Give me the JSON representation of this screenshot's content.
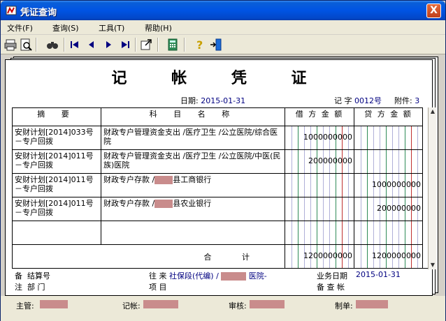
{
  "window": {
    "title": "凭证查询",
    "close_label": "X"
  },
  "menu": [
    {
      "label": "文件(F)"
    },
    {
      "label": "查询(S)"
    },
    {
      "label": "工具(T)"
    },
    {
      "label": "帮助(H)"
    }
  ],
  "toolbar": {
    "buttons": [
      "print-icon",
      "preview-icon",
      "find-icon",
      "first-record-icon",
      "prev-record-icon",
      "next-record-icon",
      "last-record-icon",
      "export-icon",
      "calculator-icon",
      "help-icon",
      "exit-icon"
    ]
  },
  "voucher": {
    "title": "记 帐 凭 证",
    "date_label": "日期:",
    "date": "2015-01-31",
    "word_label": "记 字",
    "number": "0012号",
    "attach_label": "附件:",
    "attach_count": "3",
    "headers": {
      "summary": "摘 要",
      "account": "科 目 名 称",
      "debit": "借 方 金 额",
      "credit": "贷 方 金 额"
    },
    "rows": [
      {
        "summary": "安财计划[2014]033号－专户回拨",
        "account": "财政专户管理资金支出 /医疗卫生 /公立医院/综合医院",
        "debit": "1000000000",
        "credit": ""
      },
      {
        "summary": "安财计划[2014]011号－专户回拨",
        "account": "财政专户管理资金支出 /医疗卫生 /公立医院/中医(民族)医院",
        "debit": "200000000",
        "credit": ""
      },
      {
        "summary": "安财计划[2014]011号－专户回拨",
        "account_prefix": "财政专户存款 /",
        "account_suffix": "县工商银行",
        "debit": "",
        "credit": "1000000000"
      },
      {
        "summary": "安财计划[2014]011号－专户回拨",
        "account_prefix": "财政专户存款 /",
        "account_suffix": "县农业银行",
        "debit": "",
        "credit": "200000000"
      }
    ],
    "total_label": "合 计",
    "total_debit": "1200000000",
    "total_credit": "1200000000",
    "notes": {
      "remark_label": "备",
      "remark_label2": "注",
      "settle_label": "结算号",
      "dept_label": "部 门",
      "contact_label": "往 来",
      "contact_value": "社保段(代编) /",
      "contact_suffix": "医院-",
      "project_label": "项 目",
      "bizdate_label": "业务日期",
      "bizdate": "2015-01-31",
      "check_label": "备 查 帐"
    }
  },
  "status": {
    "supervisor_label": "主管:",
    "bookkeeper_label": "记帐:",
    "auditor_label": "审核:",
    "maker_label": "制单:"
  },
  "colors": {
    "titlebar": "#0054e3",
    "redaction": "#c98c8c",
    "ledger_green": "#2e8b57",
    "ledger_red": "#c03030",
    "value_blue": "#000080"
  }
}
